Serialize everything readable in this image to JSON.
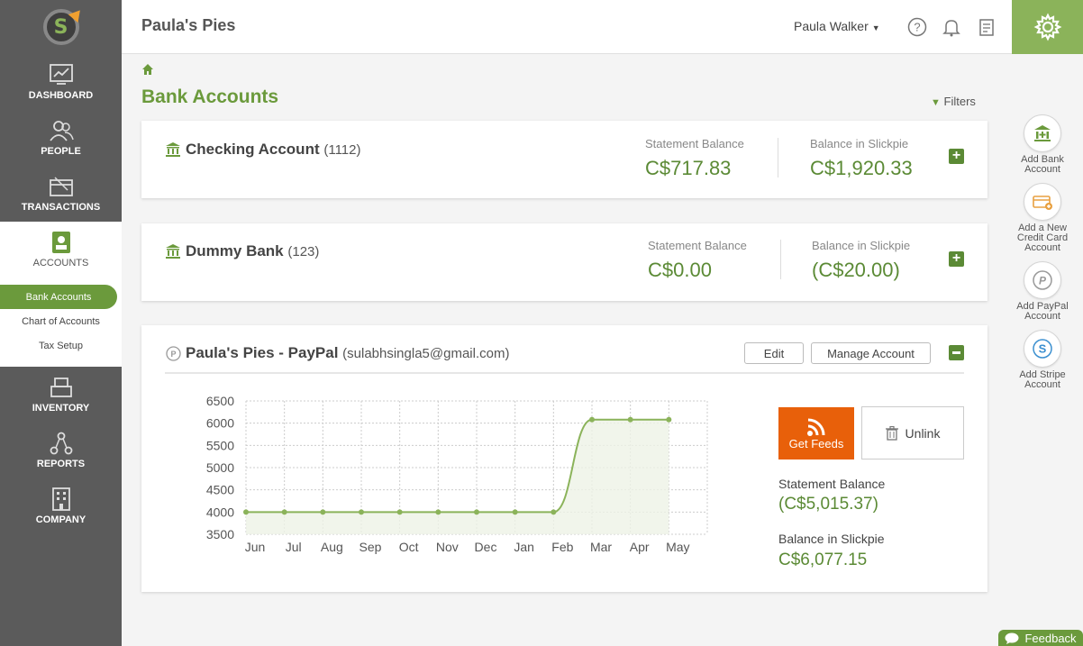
{
  "app": {
    "company": "Paula's Pies",
    "user": "Paula Walker"
  },
  "sidebar": {
    "items": [
      {
        "label": "DASHBOARD",
        "icon": "dashboard-icon"
      },
      {
        "label": "PEOPLE",
        "icon": "people-icon"
      },
      {
        "label": "TRANSACTIONS",
        "icon": "transactions-icon"
      },
      {
        "label": "ACCOUNTS",
        "icon": "accounts-icon"
      },
      {
        "label": "INVENTORY",
        "icon": "inventory-icon"
      },
      {
        "label": "REPORTS",
        "icon": "reports-icon"
      },
      {
        "label": "COMPANY",
        "icon": "company-icon"
      }
    ],
    "sub_items": [
      {
        "label": "Bank Accounts",
        "active": true
      },
      {
        "label": "Chart of Accounts"
      },
      {
        "label": "Tax Setup"
      }
    ]
  },
  "page": {
    "title": "Bank Accounts",
    "filters_label": "Filters"
  },
  "accounts": [
    {
      "name": "Checking Account",
      "number": "(1112)",
      "statement_label": "Statement Balance",
      "statement_value": "C$717.83",
      "slickpie_label": "Balance in Slickpie",
      "slickpie_value": "C$1,920.33"
    },
    {
      "name": "Dummy Bank",
      "number": "(123)",
      "statement_label": "Statement Balance",
      "statement_value": "C$0.00",
      "slickpie_label": "Balance in Slickpie",
      "slickpie_value": "(C$20.00)"
    },
    {
      "name": "Paula's Pies - PayPal",
      "number": "(sulabhsingla5@gmail.com)",
      "edit_label": "Edit",
      "manage_label": "Manage Account",
      "feeds_label": "Get Feeds",
      "unlink_label": "Unlink",
      "statement_label": "Statement Balance",
      "statement_value": "(C$5,015.37)",
      "slickpie_label": "Balance in Slickpie",
      "slickpie_value": "C$6,077.15"
    }
  ],
  "quick_actions": [
    {
      "label": "Add Bank Account"
    },
    {
      "label": "Add a New Credit Card Account"
    },
    {
      "label": "Add PayPal Account"
    },
    {
      "label": "Add Stripe Account"
    }
  ],
  "feedback_label": "Feedback",
  "colors": {
    "accent": "#6b9a3c",
    "value_green": "#5b8a35",
    "sidebar": "#5b5b5b",
    "feeds_orange": "#e8600a"
  },
  "chart_data": {
    "type": "line",
    "categories": [
      "Jun",
      "Jul",
      "Aug",
      "Sep",
      "Oct",
      "Nov",
      "Dec",
      "Jan",
      "Feb",
      "Mar",
      "Apr",
      "May"
    ],
    "series": [
      {
        "values": [
          4000,
          4000,
          4000,
          4000,
          4000,
          4000,
          4000,
          4000,
          4000,
          6080,
          6080,
          6080
        ]
      }
    ],
    "y_ticks": [
      6500,
      6000,
      5500,
      5000,
      4500,
      4000,
      3500
    ],
    "ylim": [
      3500,
      6500
    ],
    "grid": true,
    "fill": true
  }
}
